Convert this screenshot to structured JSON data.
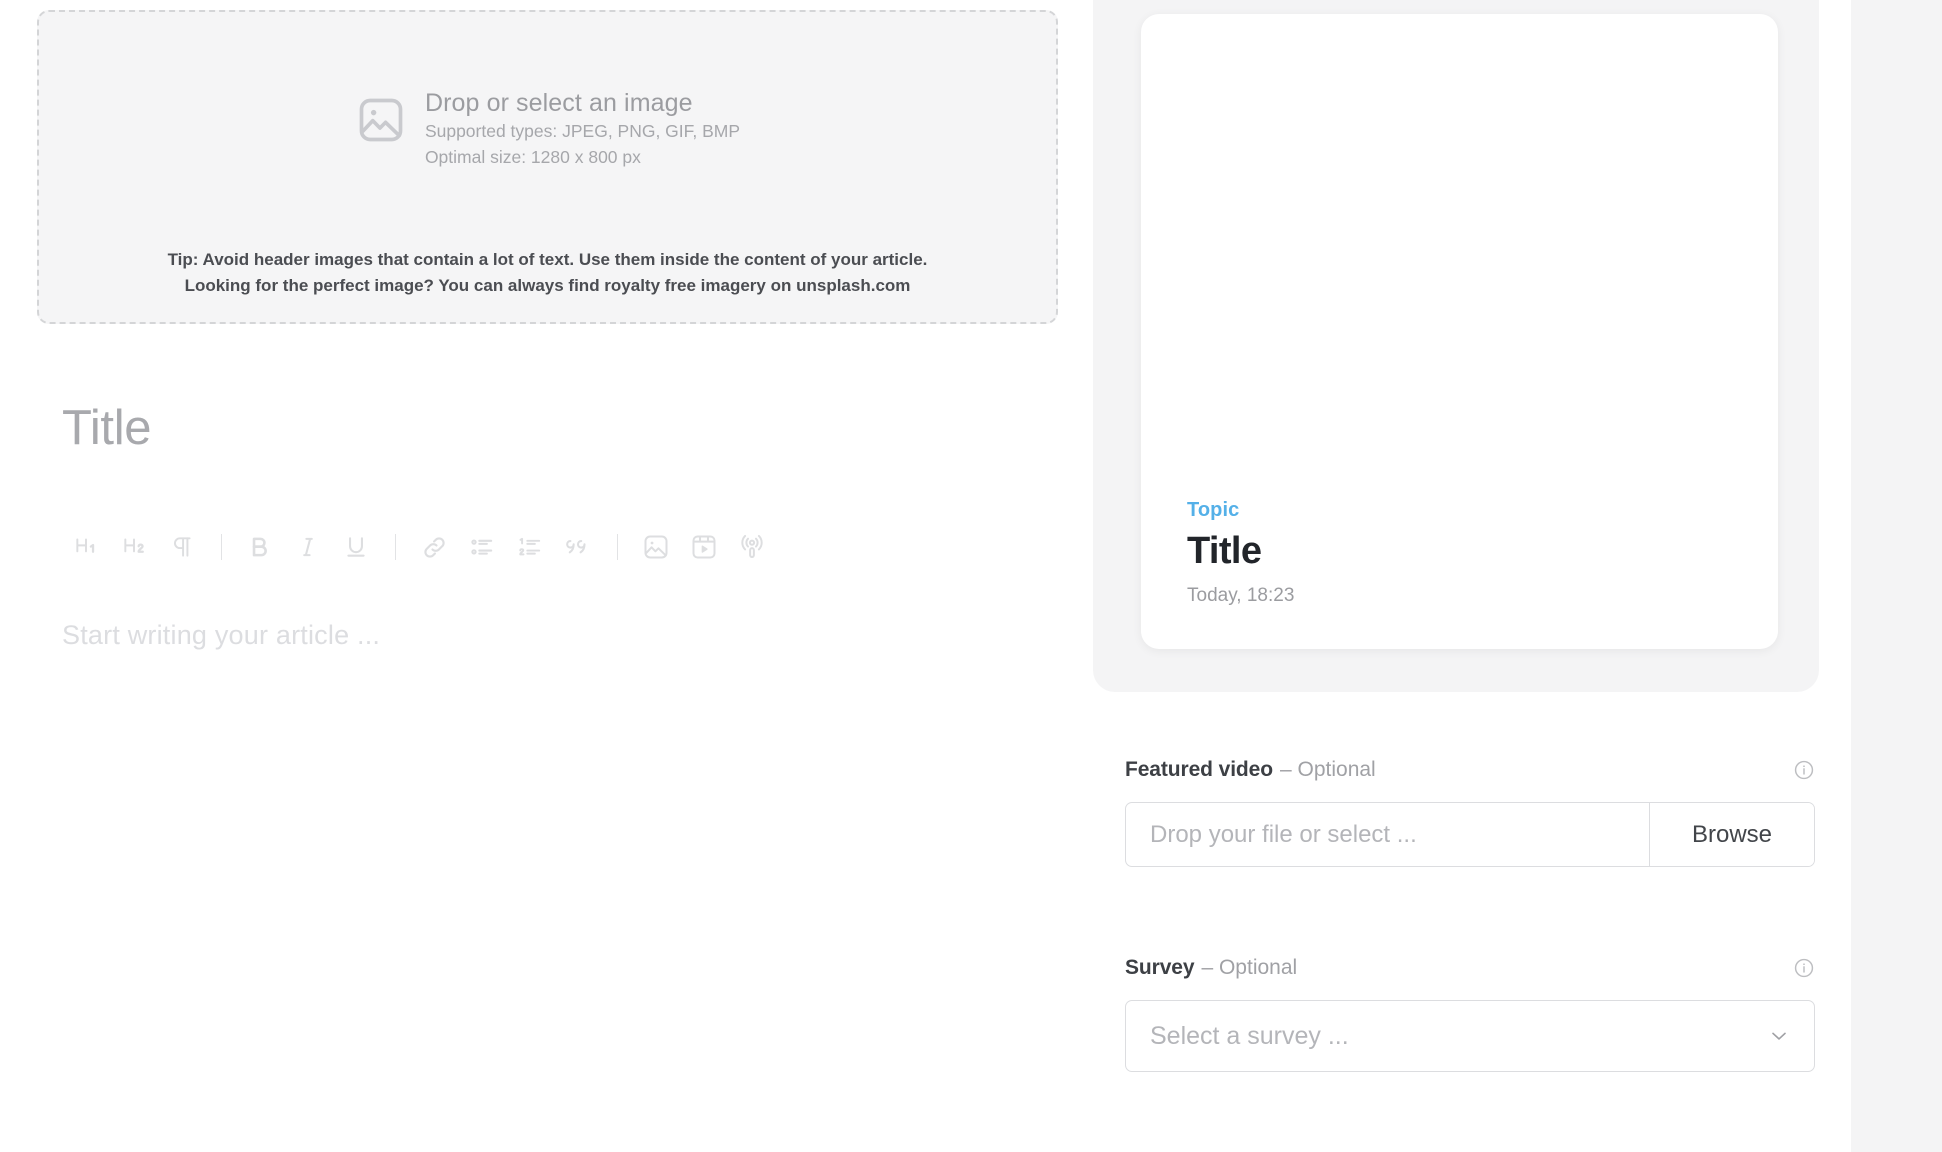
{
  "dropzone": {
    "title": "Drop or select an image",
    "supported_types": "Supported types: JPEG, PNG, GIF, BMP",
    "optimal_size": "Optimal size: 1280 x 800 px",
    "tip_line1": "Tip: Avoid header images that contain a lot of text. Use them inside the content of your article.",
    "tip_line2": "Looking for the perfect image? You can always find royalty free imagery on unsplash.com",
    "icon": "image-placeholder-icon"
  },
  "editor": {
    "title_placeholder": "Title",
    "body_placeholder": "Start writing your article ...",
    "toolbar": [
      {
        "name": "heading-1-button",
        "label": "H1",
        "icon": "heading-1-icon"
      },
      {
        "name": "heading-2-button",
        "label": "H2",
        "icon": "heading-2-icon"
      },
      {
        "name": "paragraph-button",
        "label": "¶",
        "icon": "paragraph-icon"
      },
      {
        "name": "bold-button",
        "label": "B",
        "icon": "bold-icon"
      },
      {
        "name": "italic-button",
        "label": "I",
        "icon": "italic-icon"
      },
      {
        "name": "underline-button",
        "label": "U",
        "icon": "underline-icon"
      },
      {
        "name": "link-button",
        "label": "Link",
        "icon": "link-icon"
      },
      {
        "name": "bullet-list-button",
        "label": "Bullet list",
        "icon": "bullet-list-icon"
      },
      {
        "name": "numbered-list-button",
        "label": "Numbered list",
        "icon": "numbered-list-icon"
      },
      {
        "name": "quote-button",
        "label": "Quote",
        "icon": "quote-icon"
      },
      {
        "name": "insert-image-button",
        "label": "Image",
        "icon": "image-icon"
      },
      {
        "name": "insert-video-button",
        "label": "Video",
        "icon": "video-icon"
      },
      {
        "name": "insert-podcast-button",
        "label": "Podcast",
        "icon": "podcast-icon"
      }
    ]
  },
  "preview": {
    "topic": "Topic",
    "title": "Title",
    "date": "Today, 18:23",
    "topic_color": "#54b0e8"
  },
  "featured_video": {
    "label": "Featured video",
    "optional": "– Optional",
    "placeholder": "Drop your file or select ...",
    "value": "",
    "browse_label": "Browse",
    "info_icon": "info-icon"
  },
  "survey": {
    "label": "Survey",
    "optional": "– Optional",
    "selected": "Select a survey ...",
    "caret_icon": "chevron-down-icon",
    "info_icon": "info-icon"
  }
}
